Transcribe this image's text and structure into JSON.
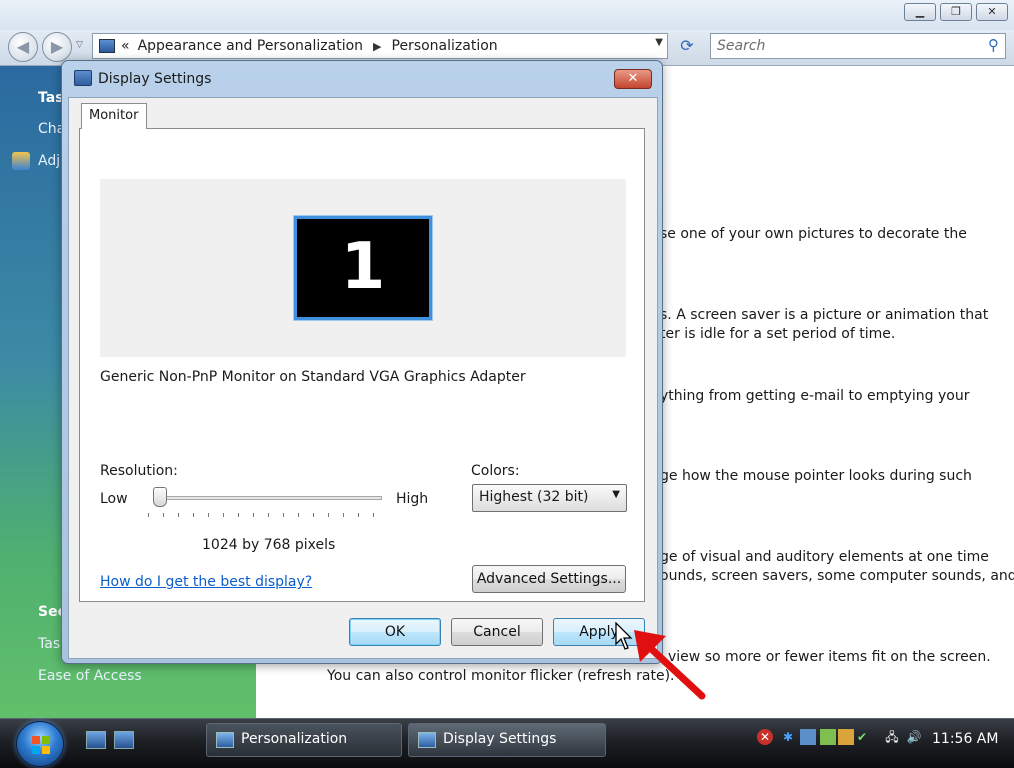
{
  "explorer": {
    "breadcrumb": [
      "Appearance and Personalization",
      "Personalization"
    ],
    "breadcrumb_prefix": "«",
    "search_placeholder": "Search",
    "sidebar": {
      "tasks_heading": "Tas",
      "task_1": "Cha",
      "task_2": "Adj",
      "see_also_heading": "See",
      "see_also_1": "Tas",
      "see_also_2": "Ease of Access"
    },
    "content_lines": [
      "se one of your own pictures to decorate the",
      "s. A screen saver is a picture or animation that",
      "ter is idle for a set period of time.",
      "ything from getting e-mail to emptying your",
      "ge how the mouse pointer looks during such",
      "ge of visual and auditory elements at one time",
      "ounds, screen savers, some computer sounds, and",
      "view so more or fewer items fit on the screen.",
      "You can also control monitor flicker (refresh rate)."
    ]
  },
  "dialog": {
    "title": "Display Settings",
    "close_label": "✕",
    "tab_label": "Monitor",
    "monitor_number": "1",
    "monitor_name": "Generic Non-PnP Monitor on Standard VGA Graphics Adapter",
    "resolution_label": "Resolution:",
    "low_label": "Low",
    "high_label": "High",
    "resolution_value": "1024 by 768 pixels",
    "resolution_slider_position": 0.05,
    "colors_label": "Colors:",
    "colors_value": "Highest (32 bit)",
    "help_link": "How do I get the best display?",
    "advanced_button": "Advanced Settings...",
    "ok_button": "OK",
    "cancel_button": "Cancel",
    "apply_button": "Apply"
  },
  "taskbar": {
    "tasks": [
      "Personalization",
      "Display Settings"
    ],
    "clock": "11:56 AM"
  },
  "colors": {
    "accent": "#3d8fe0",
    "link": "#0b5ecb",
    "annotation_arrow": "#e01010"
  }
}
